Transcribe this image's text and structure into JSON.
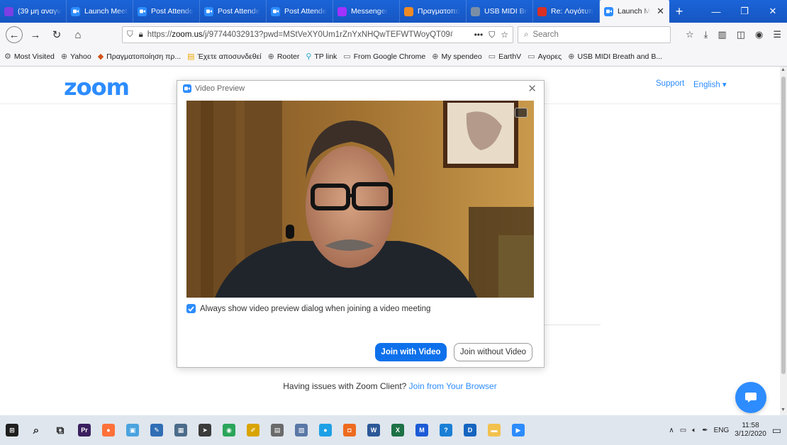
{
  "browser": {
    "tabs": [
      {
        "label": "(39 μη αναγνω",
        "icon": "mail-icon",
        "color": "#7b3fe4"
      },
      {
        "label": "Launch Meeti",
        "icon": "zoom-icon",
        "color": "#2d8cff"
      },
      {
        "label": "Post Attende",
        "icon": "zoom-icon",
        "color": "#2d8cff"
      },
      {
        "label": "Post Attende",
        "icon": "zoom-icon",
        "color": "#2d8cff"
      },
      {
        "label": "Post Attende",
        "icon": "zoom-icon",
        "color": "#2d8cff"
      },
      {
        "label": "Messenger",
        "icon": "messenger-icon",
        "color": "#a033ff"
      },
      {
        "label": "Πραγματοπο",
        "icon": "diamond-icon",
        "color": "#f08a24"
      },
      {
        "label": "USB MIDI Bre",
        "icon": "globe-icon",
        "color": "#7a8fa6"
      },
      {
        "label": "Re: Λογότυπ",
        "icon": "gmail-icon",
        "color": "#d93025"
      },
      {
        "label": "Launch M",
        "icon": "zoom-icon",
        "color": "#2d8cff",
        "active": true
      }
    ],
    "url_prefix": "https://",
    "url_domain": "zoom.us",
    "url_rest": "/j/97744032913?pwd=MStVeXY0Um1rZnYxNHQwTEFWTWoyQT09#s",
    "search_placeholder": "Search",
    "bookmarks": [
      {
        "label": "Most Visited",
        "icon": "gear-icon"
      },
      {
        "label": "Yahoo",
        "icon": "globe-icon"
      },
      {
        "label": "Πραγματοποίηση πρ...",
        "icon": "diamond-icon"
      },
      {
        "label": "Έχετε αποσυνδεθεί",
        "icon": "wix-icon"
      },
      {
        "label": "Rooter",
        "icon": "globe-icon"
      },
      {
        "label": "TP link",
        "icon": "tplink-icon"
      },
      {
        "label": "From Google Chrome",
        "icon": "folder-icon"
      },
      {
        "label": "My spendeo",
        "icon": "globe-icon"
      },
      {
        "label": "EarthV",
        "icon": "folder-icon"
      },
      {
        "label": "Αγορες",
        "icon": "folder-icon"
      },
      {
        "label": "USB MIDI Breath and B...",
        "icon": "globe-icon"
      }
    ]
  },
  "page": {
    "logo": "zoom",
    "support": "Support",
    "language": "English ▾",
    "issues_text": "Having issues with Zoom Client?",
    "issues_link": "Join from Your Browser"
  },
  "dialog": {
    "title": "Video Preview",
    "checkbox_label": "Always show video preview dialog when joining a video meeting",
    "checkbox_checked": true,
    "join_video": "Join with Video",
    "join_no_video": "Join without Video"
  },
  "taskbar": {
    "apps": [
      "windows-start-icon",
      "search-icon",
      "task-view-icon",
      "premiere-icon",
      "firefox-icon",
      "photos-icon",
      "paint-icon",
      "calculator-icon",
      "arrow-app-icon",
      "chrome-like-icon",
      "pen-icon",
      "clipboard-icon",
      "notes-icon",
      "blue-circle-icon",
      "orange-square-icon",
      "word-icon",
      "excel-icon",
      "malwarebytes-icon",
      "help-icon",
      "d-app-icon",
      "folder-icon",
      "zoom-icon"
    ],
    "lang": "ENG",
    "time": "11:58",
    "date": "3/12/2020"
  },
  "colors": {
    "accent": "#2d8cff",
    "button": "#0e71eb",
    "tabstrip": "#1656c2"
  }
}
